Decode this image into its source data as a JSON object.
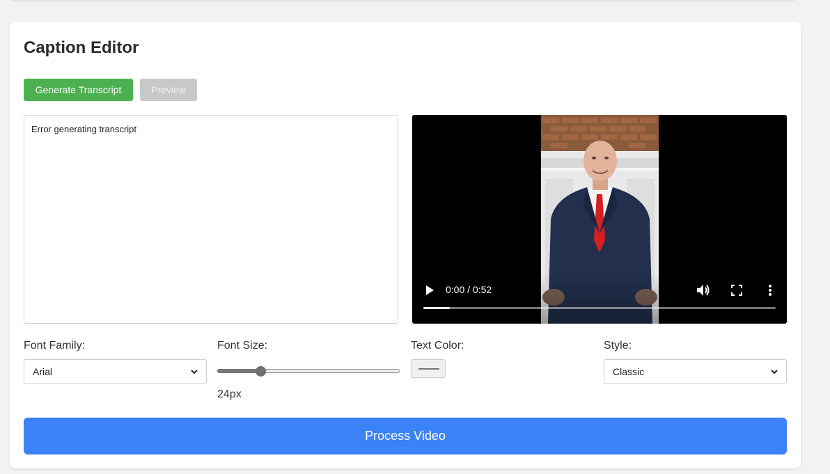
{
  "editor": {
    "title": "Caption Editor",
    "generate_label": "Generate Transcript",
    "preview_label": "Preview",
    "transcript_text": "Error generating transcript"
  },
  "video": {
    "time_label": "0:00 / 0:52",
    "progress_fraction": 0.075,
    "icons": [
      "play-icon",
      "volume-icon",
      "fullscreen-icon",
      "more-options-icon"
    ]
  },
  "controls": {
    "font_family": {
      "label": "Font Family:",
      "value": "Arial"
    },
    "font_size": {
      "label": "Font Size:",
      "value_label": "24px",
      "slider_fraction": 0.235
    },
    "text_color": {
      "label": "Text Color:",
      "value": "#777777"
    },
    "style": {
      "label": "Style:",
      "value": "Classic"
    }
  },
  "process_label": "Process Video",
  "colors": {
    "generate_bg": "#4caf50",
    "preview_bg": "#c8c8c8",
    "process_bg": "#3b82f6",
    "video_bg": "#000000"
  }
}
